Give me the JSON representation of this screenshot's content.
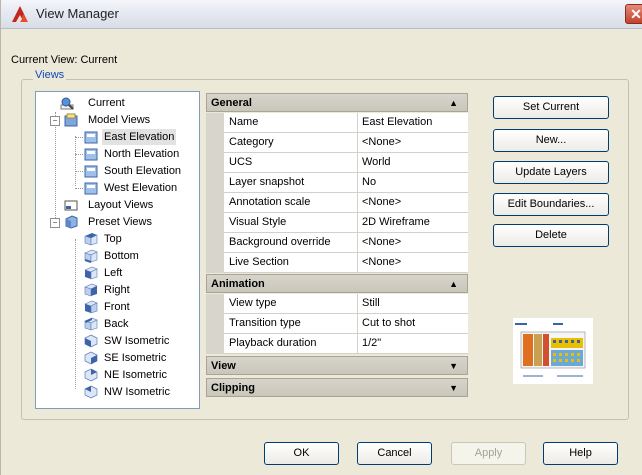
{
  "window": {
    "title": "View Manager",
    "close_glyph": "✕"
  },
  "current_view_label": "Current View: Current",
  "views_group_label": "Views",
  "tree": {
    "items": [
      {
        "label": "Current",
        "icon": "current-view-icon"
      },
      {
        "label": "Model Views",
        "icon": "model-views-icon",
        "expand": "−"
      },
      {
        "label": "East Elevation",
        "icon": "named-view-icon",
        "selected": true
      },
      {
        "label": "North Elevation",
        "icon": "named-view-icon"
      },
      {
        "label": "South Elevation",
        "icon": "named-view-icon"
      },
      {
        "label": "West Elevation",
        "icon": "named-view-icon"
      },
      {
        "label": "Layout Views",
        "icon": "layout-views-icon"
      },
      {
        "label": "Preset Views",
        "icon": "preset-views-icon",
        "expand": "−"
      },
      {
        "label": "Top",
        "icon": "cube-top-icon"
      },
      {
        "label": "Bottom",
        "icon": "cube-bottom-icon"
      },
      {
        "label": "Left",
        "icon": "cube-left-icon"
      },
      {
        "label": "Right",
        "icon": "cube-right-icon"
      },
      {
        "label": "Front",
        "icon": "cube-front-icon"
      },
      {
        "label": "Back",
        "icon": "cube-back-icon"
      },
      {
        "label": "SW Isometric",
        "icon": "isometric-icon"
      },
      {
        "label": "SE Isometric",
        "icon": "isometric-icon"
      },
      {
        "label": "NE Isometric",
        "icon": "isometric-icon"
      },
      {
        "label": "NW Isometric",
        "icon": "isometric-icon"
      }
    ]
  },
  "properties": {
    "general": {
      "title": "General",
      "arrow": "▲",
      "rows": [
        {
          "key": "Name",
          "value": "East Elevation"
        },
        {
          "key": "Category",
          "value": "<None>"
        },
        {
          "key": "UCS",
          "value": "World"
        },
        {
          "key": "Layer snapshot",
          "value": "No"
        },
        {
          "key": "Annotation scale",
          "value": "<None>"
        },
        {
          "key": "Visual Style",
          "value": "2D Wireframe"
        },
        {
          "key": "Background override",
          "value": "<None>"
        },
        {
          "key": "Live Section",
          "value": "<None>"
        }
      ]
    },
    "animation": {
      "title": "Animation",
      "arrow": "▲",
      "rows": [
        {
          "key": "View type",
          "value": "Still"
        },
        {
          "key": "Transition type",
          "value": "Cut to shot"
        },
        {
          "key": "Playback duration",
          "value": "1/2\""
        }
      ]
    },
    "view": {
      "title": "View",
      "arrow": "▼"
    },
    "clipping": {
      "title": "Clipping",
      "arrow": "▼"
    }
  },
  "side_buttons": {
    "set_current": "Set Current",
    "new": "New...",
    "update_layers": "Update Layers",
    "edit_boundaries": "Edit Boundaries...",
    "delete": "Delete"
  },
  "footer_buttons": {
    "ok": "OK",
    "cancel": "Cancel",
    "apply": "Apply",
    "help": "Help"
  },
  "colors": {
    "legend_text": "#1448b8",
    "dialog_bg": "#ece9d8",
    "button_border": "#003c74"
  }
}
